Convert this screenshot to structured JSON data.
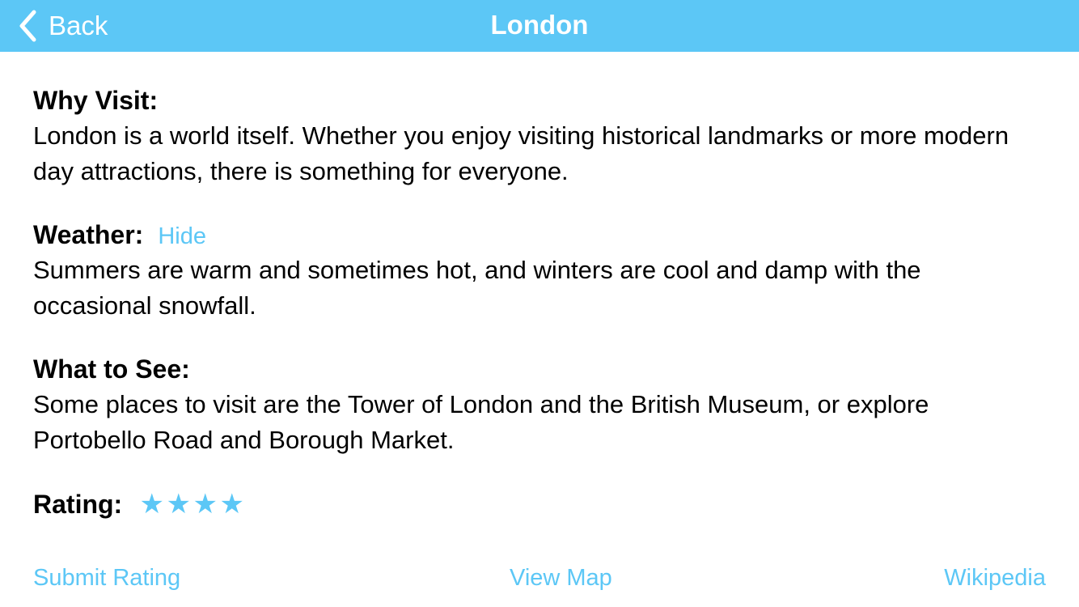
{
  "navbar": {
    "back_label": "Back",
    "title": "London",
    "back_icon": "chevron-left-icon",
    "color": "#5cc7f6"
  },
  "sections": {
    "why_visit": {
      "heading": "Why Visit:",
      "text": "London is a world itself. Whether you enjoy visiting historical landmarks or more modern day attractions, there is something for everyone."
    },
    "weather": {
      "heading": "Weather:",
      "toggle_label": "Hide",
      "text": "Summers are warm and sometimes hot, and winters are cool and damp with the occasional snowfall."
    },
    "what_to_see": {
      "heading": "What to See:",
      "text": "Some places to visit are the Tower of London and the British Museum, or explore Portobello Road and Borough Market."
    }
  },
  "rating": {
    "label": "Rating:",
    "value": 4,
    "star_glyph": "★",
    "star_icon": "star-icon",
    "color": "#5cc7f6"
  },
  "actions": {
    "submit_rating": "Submit Rating",
    "view_map": "View Map",
    "wikipedia": "Wikipedia"
  }
}
